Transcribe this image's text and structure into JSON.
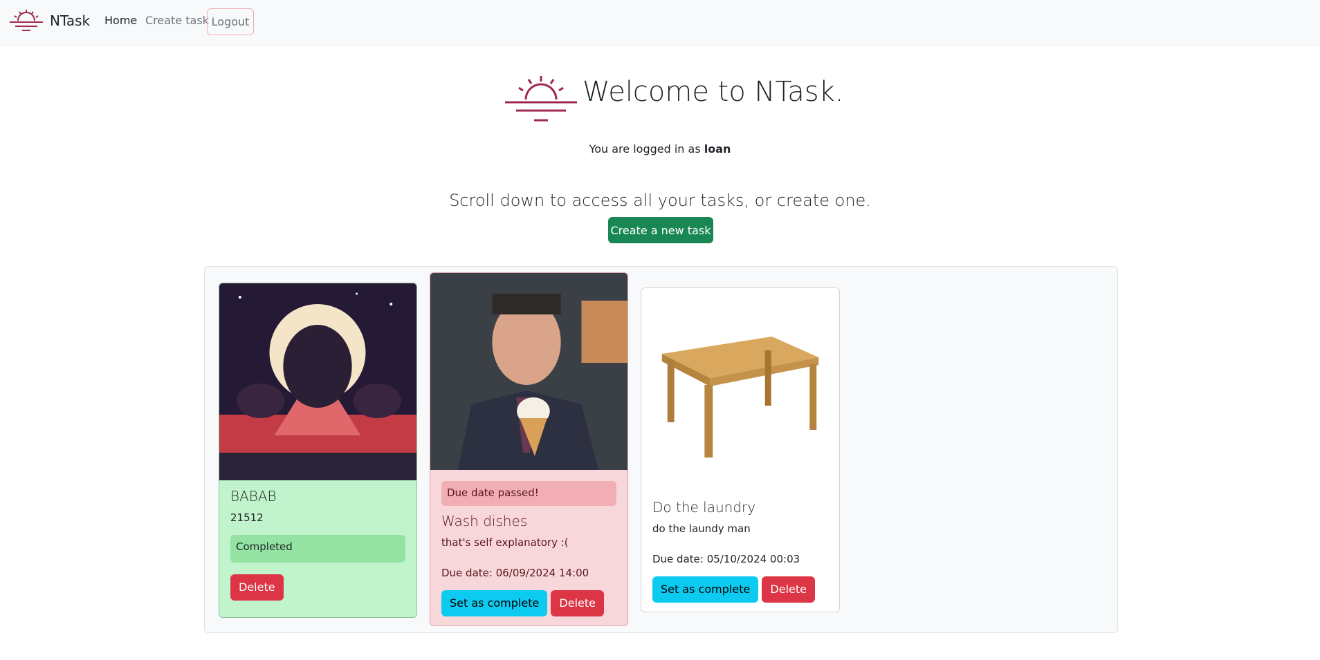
{
  "navbar": {
    "brand": "NTask",
    "home": "Home",
    "create_task": "Create task",
    "logout": "Logout"
  },
  "hero": {
    "title": "Welcome to NTask.",
    "logged_prefix": "You are logged in as",
    "username": "loan",
    "scroll_text": "Scroll down to access all your tasks, or create one.",
    "create_button": "Create a new task"
  },
  "tasks": [
    {
      "title": "BABAB",
      "description": "21512",
      "status": "Completed",
      "delete": "Delete",
      "image": "pixel-art-monster-image"
    },
    {
      "alert": "Due date passed!",
      "title": "Wash dishes",
      "description": "that's self explanatory :(",
      "due": "Due date: 06/09/2024 14:00",
      "complete": "Set as complete",
      "delete": "Delete",
      "image": "man-with-ice-cream-image"
    },
    {
      "title": "Do the laundry",
      "description": "do the laundy man",
      "due": "Due date: 05/10/2024 00:03",
      "complete": "Set as complete",
      "delete": "Delete",
      "image": "wooden-table-image"
    }
  ],
  "colors": {
    "brand": "#a0284f",
    "success": "#198754",
    "danger": "#dc3545",
    "info": "#0dcaf0"
  }
}
